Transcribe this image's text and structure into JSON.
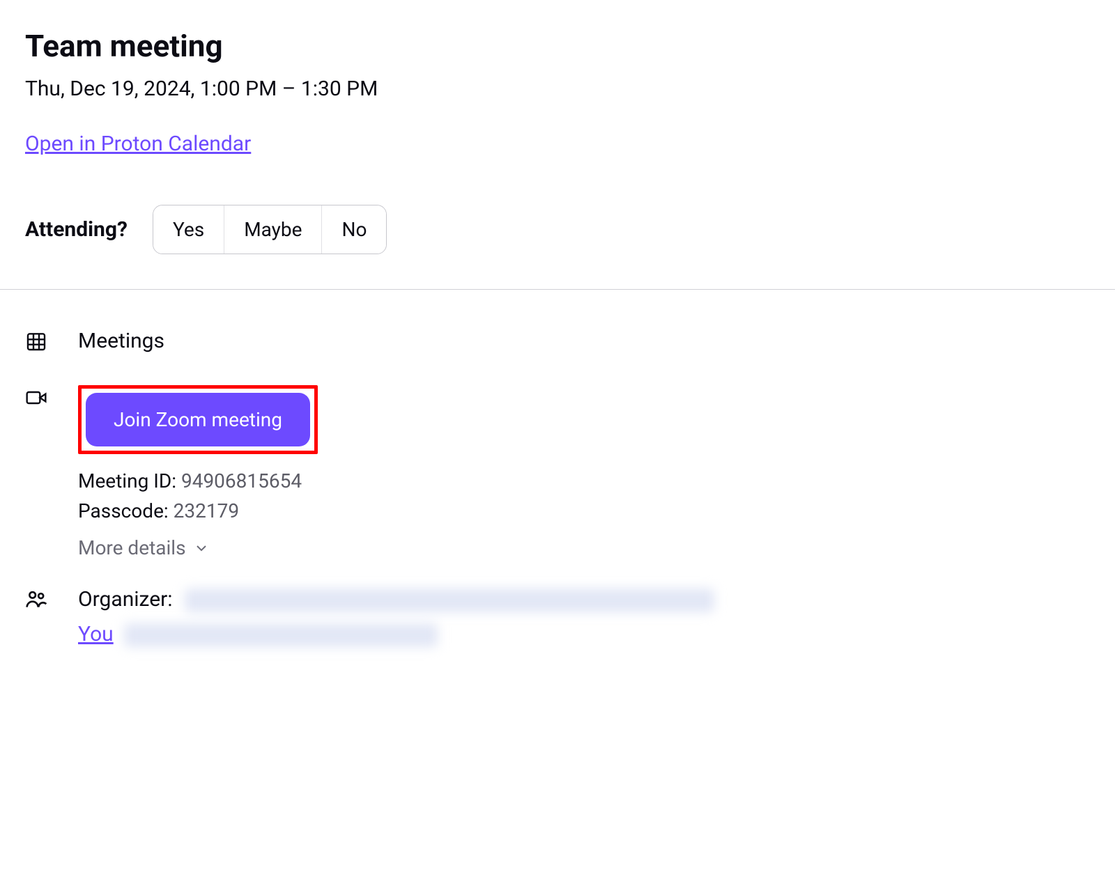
{
  "event": {
    "title": "Team meeting",
    "time_range": "Thu, Dec 19, 2024, 1:00 PM  –  1:30 PM",
    "open_link_label": "Open in Proton Calendar"
  },
  "attending": {
    "label": "Attending?",
    "yes": "Yes",
    "maybe": "Maybe",
    "no": "No"
  },
  "details": {
    "calendar_name": "Meetings",
    "join_button": "Join Zoom meeting",
    "meeting_id_label": "Meeting ID:",
    "meeting_id_value": "94906815654",
    "passcode_label": "Passcode:",
    "passcode_value": "232179",
    "more_details": "More details"
  },
  "participants": {
    "organizer_label": "Organizer:",
    "you_label": "You"
  }
}
